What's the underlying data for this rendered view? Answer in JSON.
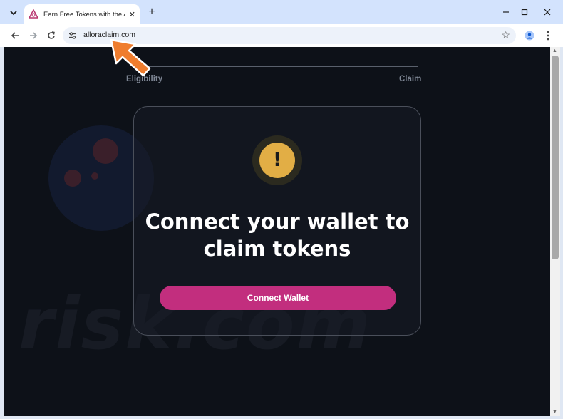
{
  "browser": {
    "tab_title": "Earn Free Tokens with the Allora",
    "tab_close": "✕",
    "new_tab": "+",
    "url": "alloraclaim.com"
  },
  "progress": {
    "steps": [
      "Eligibility",
      "Claim"
    ]
  },
  "card": {
    "icon": "!",
    "headline_line1": "Connect your wallet to",
    "headline_line2": "claim tokens",
    "button_label": "Connect Wallet"
  },
  "watermark": {
    "text": "risk.com"
  },
  "colors": {
    "page_bg": "#0d1118",
    "button": "#c22e7e",
    "warning": "#e2ae45",
    "annotation_arrow": "#ef7d2e"
  },
  "icons": [
    "tab-menu-icon",
    "favicon-icon",
    "back-icon",
    "forward-icon",
    "reload-icon",
    "site-info-icon",
    "bookmark-star-icon",
    "profile-icon",
    "kebab-menu-icon",
    "minimize-icon",
    "maximize-icon",
    "close-window-icon",
    "warning-icon",
    "annotation-arrow-icon"
  ]
}
